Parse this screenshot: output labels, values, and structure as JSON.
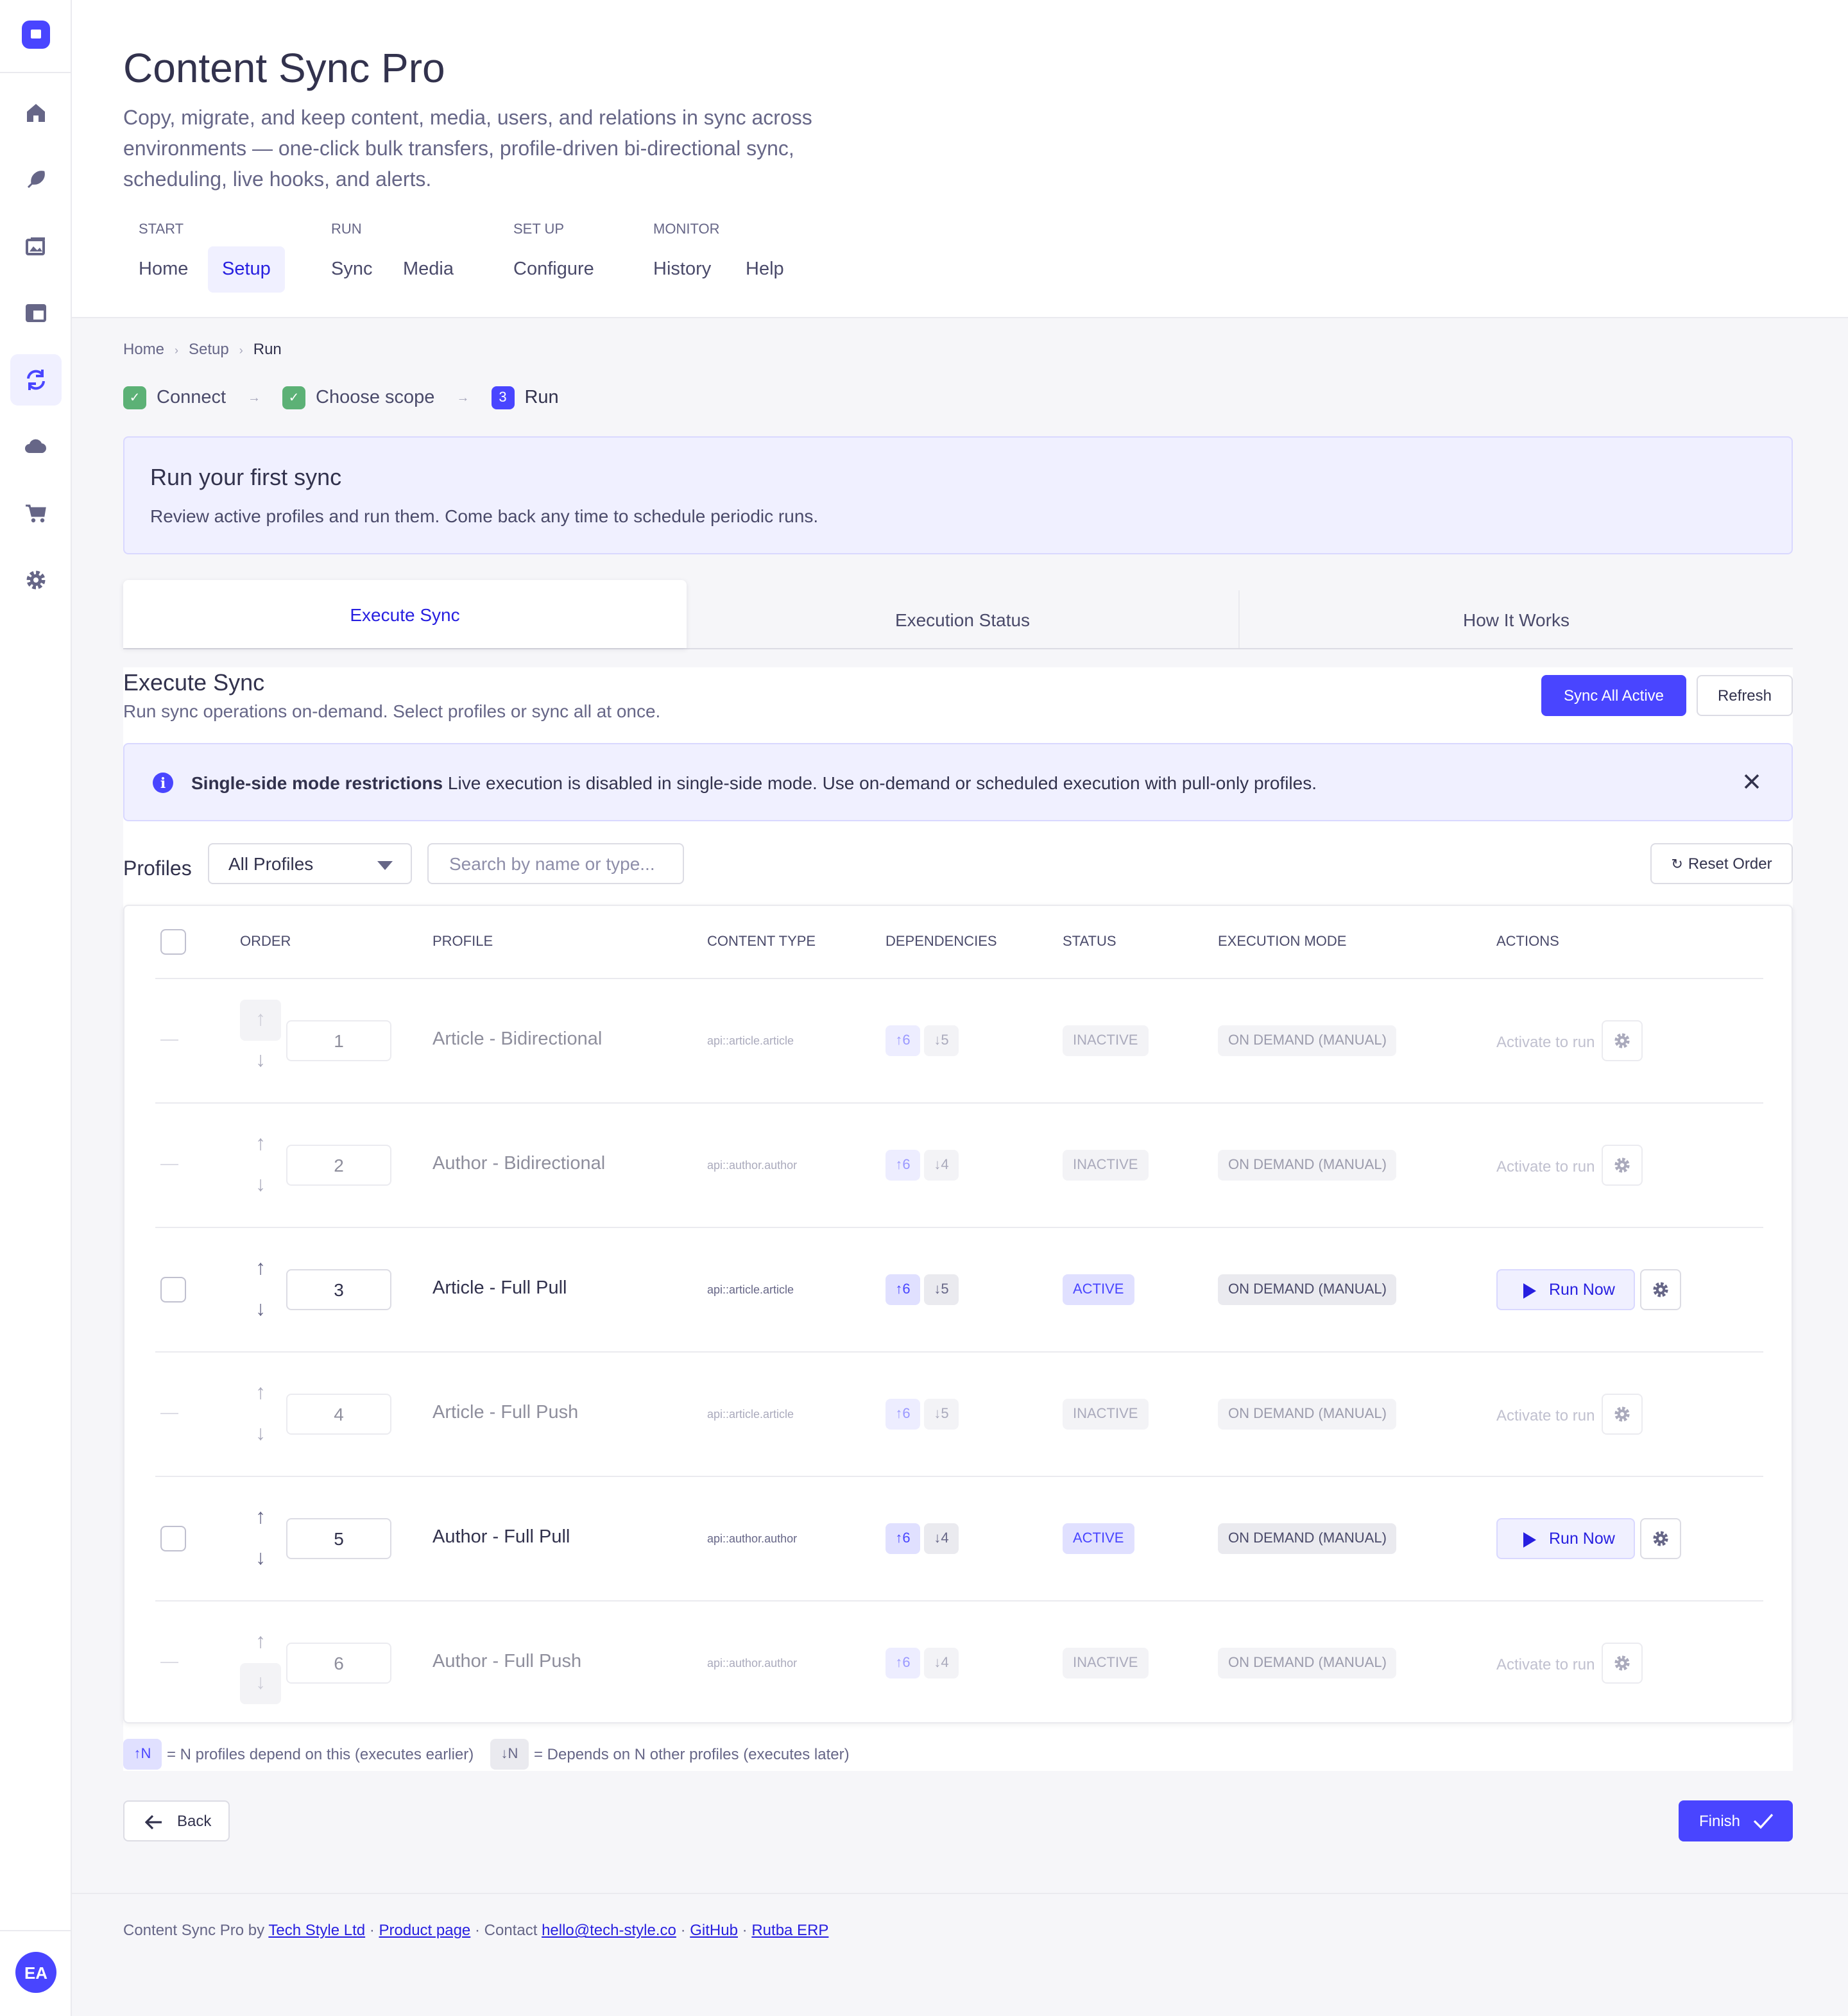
{
  "app": {
    "title": "Content Sync Pro",
    "subtitle": "Copy, migrate, and keep content, media, users, and relations in sync across environments — one-click bulk transfers, profile-driven bi-directional sync, scheduling, live hooks, and alerts.",
    "avatar_initials": "EA",
    "accent_color": "#4945ff"
  },
  "sidebar_icons": [
    "logo-icon",
    "home-icon",
    "feather-icon",
    "media-icon",
    "layout-icon",
    "sync-icon",
    "cloud-icon",
    "cart-icon",
    "gear-icon"
  ],
  "nav": {
    "groups": [
      "START",
      "RUN",
      "SET UP",
      "MONITOR"
    ],
    "tabs": [
      "Home",
      "Setup",
      "Sync",
      "Media",
      "Configure",
      "History",
      "Help"
    ],
    "selected": "Setup"
  },
  "breadcrumb": [
    "Home",
    "Setup",
    "Run"
  ],
  "steps": [
    "Connect",
    "Choose scope",
    "Run"
  ],
  "step3_number": "3",
  "hero": {
    "title": "Run your first sync",
    "text": "Review active profiles and run them. Come back any time to schedule periodic runs."
  },
  "tabs3": [
    "Execute Sync",
    "Execution Status",
    "How It Works"
  ],
  "execute": {
    "title": "Execute Sync",
    "subtitle": "Run sync operations on-demand. Select profiles or sync all at once.",
    "sync_all_label": "Sync All Active",
    "refresh_label": "Refresh"
  },
  "alert": {
    "title": "Single-side mode restrictions",
    "text": "Live execution is disabled in single-side mode. Use on-demand or scheduled execution with pull-only profiles."
  },
  "filters": {
    "label": "Profiles",
    "select_value": "All Profiles",
    "search_placeholder": "Search by name or type...",
    "reset_label": "Reset Order"
  },
  "table": {
    "headers": [
      "ORDER",
      "PROFILE",
      "CONTENT TYPE",
      "DEPENDENCIES",
      "STATUS",
      "EXECUTION MODE",
      "ACTIONS"
    ],
    "rows": [
      {
        "order": "1",
        "name": "Article - Bidirectional",
        "type": "api::article.article",
        "dep_up": "↑6",
        "dep_down": "↓5",
        "status": "INACTIVE",
        "mode": "ON DEMAND (MANUAL)",
        "action": "Activate to run"
      },
      {
        "order": "2",
        "name": "Author - Bidirectional",
        "type": "api::author.author",
        "dep_up": "↑6",
        "dep_down": "↓4",
        "status": "INACTIVE",
        "mode": "ON DEMAND (MANUAL)",
        "action": "Activate to run"
      },
      {
        "order": "3",
        "name": "Article - Full Pull",
        "type": "api::article.article",
        "dep_up": "↑6",
        "dep_down": "↓5",
        "status": "ACTIVE",
        "mode": "ON DEMAND (MANUAL)",
        "action": "Run Now"
      },
      {
        "order": "4",
        "name": "Article - Full Push",
        "type": "api::article.article",
        "dep_up": "↑6",
        "dep_down": "↓5",
        "status": "INACTIVE",
        "mode": "ON DEMAND (MANUAL)",
        "action": "Activate to run"
      },
      {
        "order": "5",
        "name": "Author - Full Pull",
        "type": "api::author.author",
        "dep_up": "↑6",
        "dep_down": "↓4",
        "status": "ACTIVE",
        "mode": "ON DEMAND (MANUAL)",
        "action": "Run Now"
      },
      {
        "order": "6",
        "name": "Author - Full Push",
        "type": "api::author.author",
        "dep_up": "↑6",
        "dep_down": "↓4",
        "status": "INACTIVE",
        "mode": "ON DEMAND (MANUAL)",
        "action": "Activate to run"
      }
    ]
  },
  "legend": {
    "up_pill": "↑N",
    "up_text": "= N profiles depend on this (executes earlier)",
    "down_pill": "↓N",
    "down_text": "= Depends on N other profiles (executes later)"
  },
  "back_label": "Back",
  "finish_label": "Finish",
  "footer": {
    "prefix": "Content Sync Pro by",
    "company": "Tech Style Ltd",
    "product_page": "Product page",
    "contact_prefix": "Contact",
    "email": "hello@tech-style.co",
    "github": "GitHub",
    "erp": "Rutba ERP",
    "sep": "·"
  }
}
